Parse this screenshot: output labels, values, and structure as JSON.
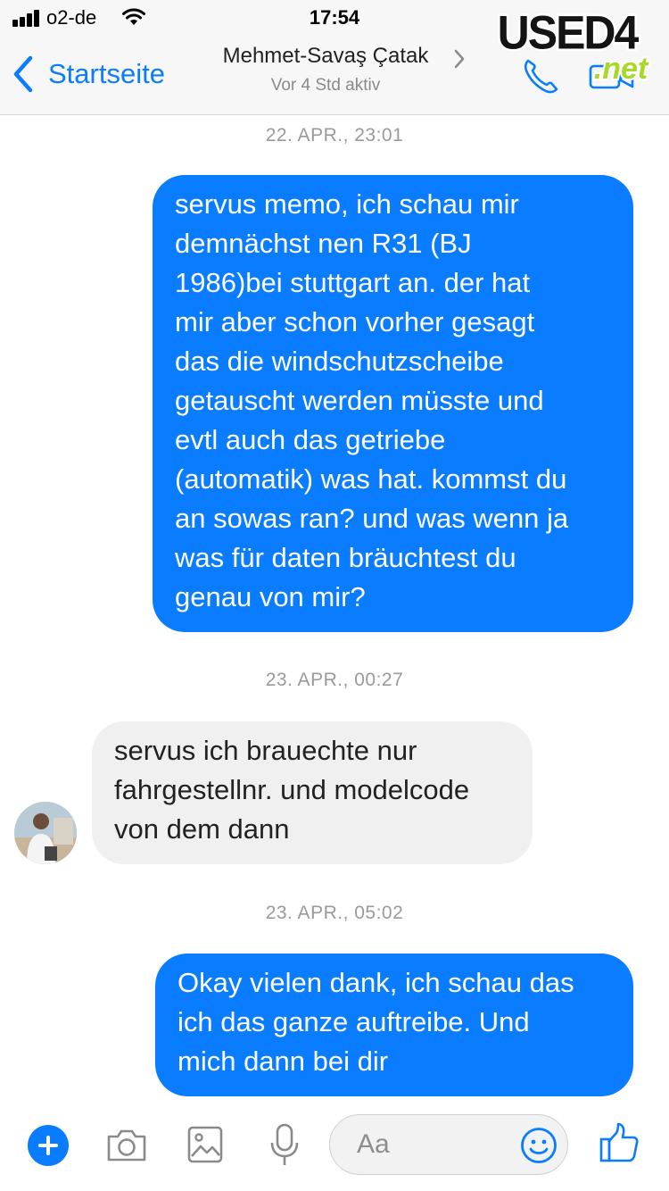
{
  "status_bar": {
    "carrier": "o2-de",
    "time": "17:54"
  },
  "header": {
    "back_label": "Startseite",
    "contact_name": "Mehmet-Savaş Çatak",
    "contact_status": "Vor 4 Std aktiv"
  },
  "watermark": {
    "text": "USED4",
    "suffix": ".net"
  },
  "conversation": {
    "timestamps": [
      "22. APR., 23:01",
      "23. APR., 00:27",
      "23. APR., 05:02"
    ],
    "messages": [
      {
        "direction": "outgoing",
        "lines": [
          "servus memo, ich schau mir",
          "demnächst nen R31 (BJ",
          "1986)bei stuttgart an. der hat",
          "mir aber schon vorher gesagt",
          "das die windschutzscheibe",
          "getauscht werden müsste und",
          "evtl auch das getriebe",
          "(automatik) was hat. kommst du",
          "an sowas ran? und was wenn ja",
          "was für daten bräuchtest du",
          "genau von mir?"
        ]
      },
      {
        "direction": "incoming",
        "lines": [
          "servus ich brauechte nur",
          "fahrgestellnr. und modelcode",
          "von dem dann"
        ]
      },
      {
        "direction": "outgoing",
        "lines": [
          "Okay vielen dank, ich schau das",
          "ich das ganze auftreibe.  Und",
          "mich dann bei dir"
        ]
      }
    ]
  },
  "composer": {
    "placeholder": "Aa"
  },
  "colors": {
    "accent": "#0a7cff",
    "incoming_bubble": "#f0f0f0",
    "header_bg": "#f7f7f7"
  }
}
